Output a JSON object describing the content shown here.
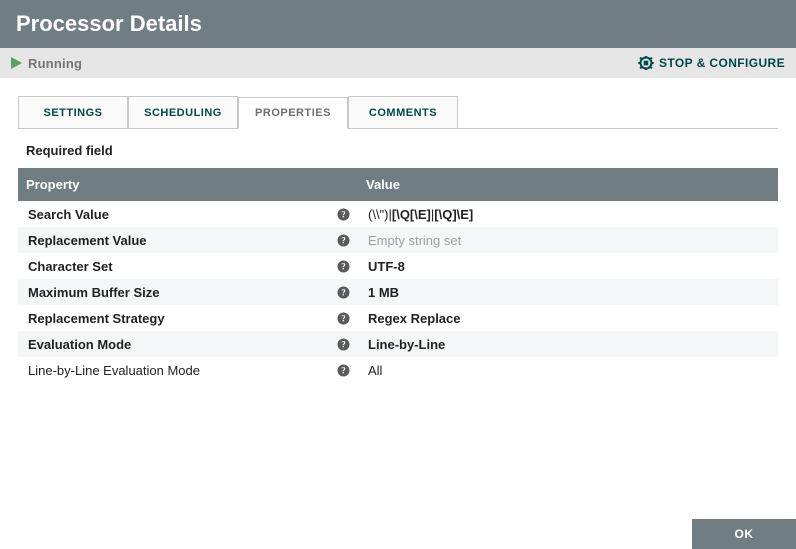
{
  "header": {
    "title": "Processor Details"
  },
  "status": {
    "label": "Running",
    "stop_configure": "STOP & CONFIGURE"
  },
  "tabs": [
    {
      "label": "SETTINGS",
      "active": false
    },
    {
      "label": "SCHEDULING",
      "active": false
    },
    {
      "label": "PROPERTIES",
      "active": true
    },
    {
      "label": "COMMENTS",
      "active": false
    }
  ],
  "required_field_label": "Required field",
  "table_headers": {
    "property": "Property",
    "value": "Value"
  },
  "properties": [
    {
      "name": "Search Value",
      "value_html": true,
      "value": "",
      "required": true
    },
    {
      "name": "Replacement Value",
      "value": "Empty string set",
      "required": true,
      "placeholder": true
    },
    {
      "name": "Character Set",
      "value": "UTF-8",
      "required": true
    },
    {
      "name": "Maximum Buffer Size",
      "value": "1 MB",
      "required": true
    },
    {
      "name": "Replacement Strategy",
      "value": "Regex Replace",
      "required": true
    },
    {
      "name": "Evaluation Mode",
      "value": "Line-by-Line",
      "required": true
    },
    {
      "name": "Line-by-Line Evaluation Mode",
      "value": "All",
      "required": false
    }
  ],
  "search_value_parts": [
    {
      "t": "(\\\\\")|",
      "b": false
    },
    {
      "t": "[\\Q[\\E]",
      "b": true
    },
    {
      "t": "|",
      "b": false
    },
    {
      "t": "[\\Q]\\E]",
      "b": true
    }
  ],
  "footer": {
    "ok": "OK"
  }
}
